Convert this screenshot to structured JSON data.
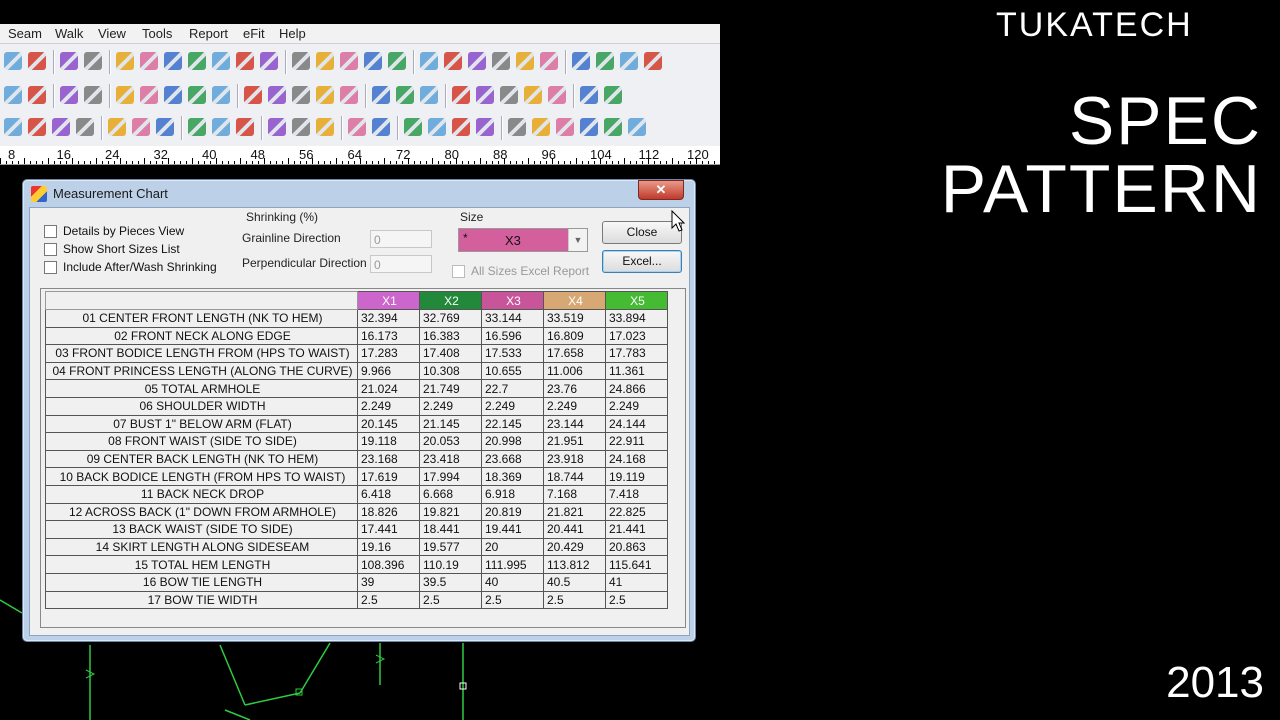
{
  "menu": [
    "Seam",
    "Walk",
    "View",
    "Tools",
    "Report",
    "eFit",
    "Help"
  ],
  "ruler": [
    "8",
    "16",
    "24",
    "32",
    "40",
    "48",
    "56",
    "64",
    "72",
    "80",
    "88",
    "96",
    "104",
    "112",
    "120"
  ],
  "dialog": {
    "title": "Measurement Chart",
    "close_glyph": "✕",
    "options": [
      {
        "label": "Details by Pieces View",
        "checked": false
      },
      {
        "label": "Show Short Sizes List",
        "checked": false
      },
      {
        "label": "Include After/Wash Shrinking",
        "checked": false
      }
    ],
    "shrinking": {
      "title": "Shrinking (%)",
      "grainline_label": "Grainline Direction",
      "grainline_value": "0",
      "perpendicular_label": "Perpendicular Direction",
      "perpendicular_value": "0"
    },
    "size": {
      "label": "Size",
      "marker": "*",
      "selected": "X3",
      "all_sizes_label": "All Sizes Excel Report"
    },
    "buttons": {
      "close": "Close",
      "excel": "Excel..."
    }
  },
  "table": {
    "sizes": [
      {
        "name": "X1",
        "color": "#cc66cc"
      },
      {
        "name": "X2",
        "color": "#22883a"
      },
      {
        "name": "X3",
        "color": "#c8559a"
      },
      {
        "name": "X4",
        "color": "#d8a874"
      },
      {
        "name": "X5",
        "color": "#44bb33"
      }
    ],
    "rows": [
      {
        "name": "01 CENTER FRONT LENGTH (NK TO HEM)",
        "values": [
          "32.394",
          "32.769",
          "33.144",
          "33.519",
          "33.894"
        ]
      },
      {
        "name": "02 FRONT NECK ALONG EDGE",
        "values": [
          "16.173",
          "16.383",
          "16.596",
          "16.809",
          "17.023"
        ]
      },
      {
        "name": "03 FRONT BODICE LENGTH FROM (HPS TO WAIST)",
        "values": [
          "17.283",
          "17.408",
          "17.533",
          "17.658",
          "17.783"
        ]
      },
      {
        "name": "04 FRONT PRINCESS LENGTH (ALONG THE CURVE)",
        "values": [
          "9.966",
          "10.308",
          "10.655",
          "11.006",
          "11.361"
        ]
      },
      {
        "name": "05 TOTAL ARMHOLE",
        "values": [
          "21.024",
          "21.749",
          "22.7",
          "23.76",
          "24.866"
        ]
      },
      {
        "name": "06 SHOULDER WIDTH",
        "values": [
          "2.249",
          "2.249",
          "2.249",
          "2.249",
          "2.249"
        ]
      },
      {
        "name": "07 BUST 1\" BELOW ARM (FLAT)",
        "values": [
          "20.145",
          "21.145",
          "22.145",
          "23.144",
          "24.144"
        ]
      },
      {
        "name": "08 FRONT WAIST (SIDE TO SIDE)",
        "values": [
          "19.118",
          "20.053",
          "20.998",
          "21.951",
          "22.911"
        ]
      },
      {
        "name": "09 CENTER BACK LENGTH (NK TO HEM)",
        "values": [
          "23.168",
          "23.418",
          "23.668",
          "23.918",
          "24.168"
        ]
      },
      {
        "name": "10 BACK BODICE LENGTH (FROM HPS TO WAIST)",
        "values": [
          "17.619",
          "17.994",
          "18.369",
          "18.744",
          "19.119"
        ]
      },
      {
        "name": "11 BACK NECK DROP",
        "values": [
          "6.418",
          "6.668",
          "6.918",
          "7.168",
          "7.418"
        ]
      },
      {
        "name": "12 ACROSS BACK (1\" DOWN FROM ARMHOLE)",
        "values": [
          "18.826",
          "19.821",
          "20.819",
          "21.821",
          "22.825"
        ]
      },
      {
        "name": "13 BACK WAIST (SIDE TO SIDE)",
        "values": [
          "17.441",
          "18.441",
          "19.441",
          "20.441",
          "21.441"
        ]
      },
      {
        "name": "14 SKIRT LENGTH ALONG SIDESEAM",
        "values": [
          "19.16",
          "19.577",
          "20",
          "20.429",
          "20.863"
        ]
      },
      {
        "name": "15 TOTAL HEM LENGTH",
        "values": [
          "108.396",
          "110.19",
          "111.995",
          "113.812",
          "115.641"
        ]
      },
      {
        "name": "16 BOW TIE LENGTH",
        "values": [
          "39",
          "39.5",
          "40",
          "40.5",
          "41"
        ]
      },
      {
        "name": "17 BOW TIE WIDTH",
        "values": [
          "2.5",
          "2.5",
          "2.5",
          "2.5",
          "2.5"
        ]
      }
    ]
  },
  "overlay": {
    "brand": "TUKATECH",
    "title_line1": "SPEC",
    "title_line2": "PATTERN",
    "year": "2013"
  }
}
